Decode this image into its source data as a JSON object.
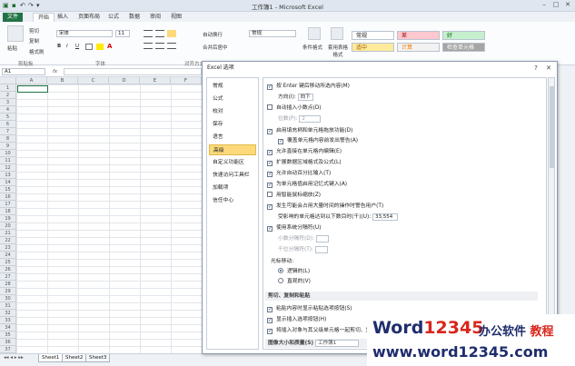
{
  "window": {
    "title": "工作簿1 - Microsoft Excel",
    "controls": [
      "–",
      "□",
      "✕"
    ]
  },
  "qat": {
    "save_icon": "save-icon",
    "undo": "↶",
    "redo": "↷",
    "more": "▾"
  },
  "tabs": [
    {
      "label": "文件"
    },
    {
      "label": "开始"
    },
    {
      "label": "插入"
    },
    {
      "label": "页面布局"
    },
    {
      "label": "公式"
    },
    {
      "label": "数据"
    },
    {
      "label": "审阅"
    },
    {
      "label": "视图"
    }
  ],
  "ribbon": {
    "clipboard": {
      "cut": "剪切",
      "copy": "复制",
      "format_painter": "格式刷",
      "paste": "粘贴",
      "group": "剪贴板"
    },
    "font": {
      "name": "宋体",
      "size": "11",
      "bold": "B",
      "italic": "I",
      "underline": "U",
      "group": "字体"
    },
    "alignment": {
      "wrap": "自动换行",
      "merge": "合并后居中",
      "group": "对齐方式"
    },
    "number": {
      "format": "常规",
      "group": "数字"
    },
    "styles": {
      "conditional": "条件格式",
      "table": "套用表格格式",
      "cells": [
        {
          "label": "常规",
          "bg": "#ffffff",
          "fg": "#222222"
        },
        {
          "label": "差",
          "bg": "#ffc7ce",
          "fg": "#9c0006"
        },
        {
          "label": "好",
          "bg": "#c6efce",
          "fg": "#006100"
        },
        {
          "label": "适中",
          "bg": "#ffeb9c",
          "fg": "#9c5700"
        },
        {
          "label": "计算",
          "bg": "#f2f2f2",
          "fg": "#fa7d00"
        },
        {
          "label": "检查单元格",
          "bg": "#a5a5a5",
          "fg": "#ffffff"
        }
      ],
      "group": "样式"
    }
  },
  "formula_bar": {
    "name_box": "A1",
    "fx": "fx"
  },
  "grid": {
    "columns": [
      "A",
      "B",
      "C",
      "D",
      "E",
      "F"
    ],
    "rows": [
      "1",
      "2",
      "3",
      "4",
      "5",
      "6",
      "7",
      "8",
      "9",
      "10",
      "11",
      "12",
      "13",
      "14",
      "15",
      "16",
      "17",
      "18",
      "19",
      "20",
      "21",
      "22",
      "23",
      "24",
      "25",
      "26",
      "27",
      "28",
      "29",
      "30",
      "31",
      "32",
      "33",
      "34",
      "35",
      "36",
      "37"
    ]
  },
  "sheets": [
    {
      "label": "Sheet1"
    },
    {
      "label": "Sheet2"
    },
    {
      "label": "Sheet3"
    }
  ],
  "dialog": {
    "title": "Excel 选项",
    "nav": [
      {
        "label": "常规"
      },
      {
        "label": "公式"
      },
      {
        "label": "校对"
      },
      {
        "label": "保存"
      },
      {
        "label": "语言"
      },
      {
        "label": "高级"
      },
      {
        "label": "自定义功能区"
      },
      {
        "label": "快速访问工具栏"
      },
      {
        "label": "加载项"
      },
      {
        "label": "信任中心"
      }
    ],
    "options": {
      "enter_move": "按 Enter 键后移动所选内容(M)",
      "direction_label": "方向(I):",
      "direction_value": "向下",
      "auto_decimal": "自动插入小数点(D)",
      "places_label": "位数(P):",
      "places_value": "2",
      "fill_handle": "启用填充柄和单元格拖放功能(D)",
      "alert_overwrite": "覆盖单元格内容前发出警告(A)",
      "edit_in_cell": "允许直接在单元格内编辑(E)",
      "extend_formats": "扩展数据区域格式及公式(L)",
      "auto_percent": "允许自动百分比输入(T)",
      "autocomplete": "为单元格值启用记忆式键入(A)",
      "intellimouse": "用智能鼠标缩放(Z)",
      "alert_slow": "发生可能会占用大量时间的操作时警告用户(T)",
      "cells_threshold_label": "受影响的单元格达到以下数目时(千)(U):",
      "cells_threshold_value": "33,554",
      "system_separators": "使用系统分隔符(U)",
      "decimal_sep": "小数分隔符(D):",
      "thousands_sep": "千位分隔符(T):",
      "cursor_movement": "光标移动:",
      "logical": "逻辑的(L)",
      "visual": "直观的(V)",
      "section_cut_copy": "剪切、复制和粘贴",
      "paste_options": "粘贴内容时显示粘贴选项按钮(S)",
      "insert_options": "显示插入选项按钮(H)",
      "sort_objects": "将插入对象与其父级单元格一起剪切、复制",
      "image_size_label": "图像大小和质量(S)",
      "image_size_value": "工作簿1"
    }
  },
  "watermark": {
    "logo_word": "Word",
    "logo_num": "12345",
    "cn_a": "办公软件",
    "cn_b": "教程",
    "url": "www.word12345.com"
  }
}
